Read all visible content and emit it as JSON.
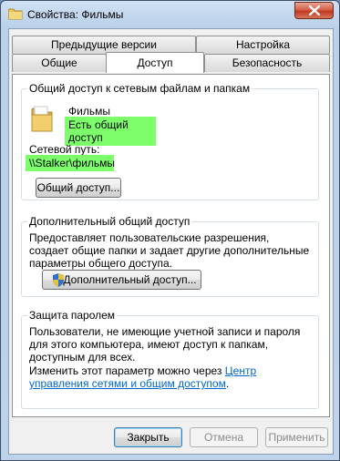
{
  "window": {
    "title": "Свойства: Фильмы"
  },
  "tabs": {
    "row1": [
      "Предыдущие версии",
      "Настройка"
    ],
    "row2": [
      "Общие",
      "Доступ",
      "Безопасность"
    ],
    "active": "Доступ"
  },
  "sharing_group": {
    "title": "Общий доступ к сетевым файлам и папкам",
    "folder_name": "Фильмы",
    "status": "Есть общий доступ",
    "network_path_label": "Сетевой путь:",
    "network_path": "\\\\Stalker\\фильмы",
    "share_button": "Общий доступ..."
  },
  "advanced_group": {
    "title": "Дополнительный общий доступ",
    "description": "Предоставляет пользовательские разрешения, создает общие папки и задает другие дополнительные параметры общего доступа.",
    "button": "Дополнительный доступ..."
  },
  "password_group": {
    "title": "Защита паролем",
    "description": "Пользователи, не имеющие учетной записи и пароля для этого компьютера, имеют доступ к папкам, доступным для всех.",
    "change_text": "Изменить этот параметр можно через",
    "link_text": "Центр управления сетями и общим доступом",
    "link_suffix": "."
  },
  "buttons": {
    "ok": "Закрыть",
    "cancel": "Отмена",
    "apply": "Применить"
  },
  "colors": {
    "highlight": "#7dff6b",
    "link": "#0066cc"
  }
}
